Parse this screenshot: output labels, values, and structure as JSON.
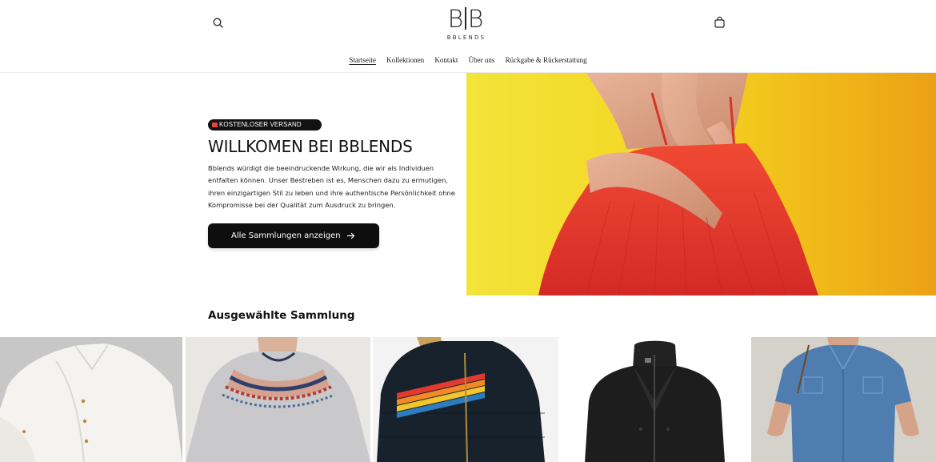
{
  "header": {
    "logo": {
      "mark_left": "B",
      "mark_right": "B",
      "text": "BBLENDS"
    },
    "search_icon": "search-icon",
    "cart_icon": "cart-bag-icon"
  },
  "nav": {
    "items": [
      {
        "label": "Startseite",
        "active": true
      },
      {
        "label": "Kollektionen",
        "active": false
      },
      {
        "label": "Kontakt",
        "active": false
      },
      {
        "label": "Über uns",
        "active": false
      },
      {
        "label": "Rückgabe & Rückerstattung",
        "active": false
      }
    ]
  },
  "hero": {
    "badge": "KOSTENLOSER VERSAND",
    "badge_icon": "truck-icon",
    "title": "WILLKOMEN BEI BBLENDS",
    "body": "Bblends würdigt die beeindruckende Wirkung, die wir als Individuen entfalten können. Unser Bestreben ist es, Menschen dazu zu ermutigen, ihren einzigartigen Stil zu leben und ihre authentische Persönlichkeit ohne Kompromisse bei der Qualität zum Ausdruck zu bringen.",
    "cta_label": "Alle Sammlungen anzeigen",
    "cta_icon": "arrow-right-icon",
    "image_colors": {
      "background": "#f4d622",
      "dress": "#e8352e"
    }
  },
  "featured": {
    "title": "Ausgewählte Sammlung",
    "products": [
      {
        "name": "white-shirt",
        "bg": "#c9c9c9"
      },
      {
        "name": "fair-isle-sweater",
        "bg": "#e9e9e7"
      },
      {
        "name": "rainbow-puffer-jacket",
        "bg": "#f2f2f2"
      },
      {
        "name": "black-wool-coat",
        "bg": "#ffffff"
      },
      {
        "name": "denim-shirt-dress",
        "bg": "#d8d4cf"
      }
    ]
  }
}
